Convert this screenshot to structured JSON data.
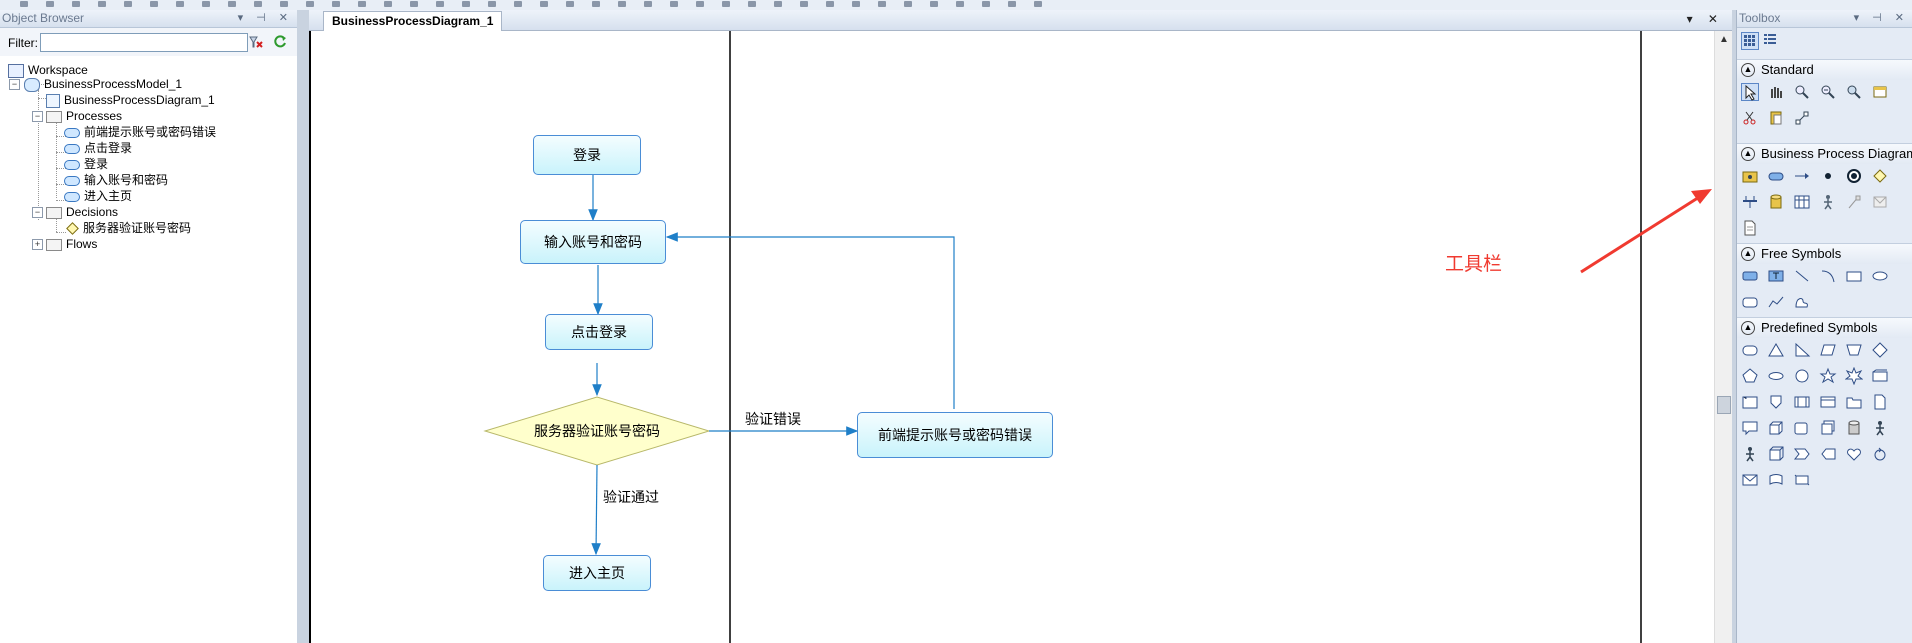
{
  "object_browser": {
    "title": "Object Browser",
    "header_controls": "▾ ⊣ ✕",
    "filter_label": "Filter:",
    "filter_value": "",
    "tree": {
      "workspace": "Workspace",
      "model": "BusinessProcessModel_1",
      "diagram": "BusinessProcessDiagram_1",
      "processes_folder": "Processes",
      "processes": [
        "前端提示账号或密码错误",
        "点击登录",
        "登录",
        "输入账号和密码",
        "进入主页"
      ],
      "decisions_folder": "Decisions",
      "decisions": [
        "服务器验证账号密码"
      ],
      "flows_folder": "Flows"
    }
  },
  "document": {
    "tab_label": "BusinessProcessDiagram_1",
    "tab_controls": "▾ ✕",
    "scroll_up_glyph": "▲"
  },
  "diagram": {
    "nodes": {
      "login": "登录",
      "enter_credentials": "输入账号和密码",
      "click_login": "点击登录",
      "server_verify": "服务器验证账号密码",
      "enter_home": "进入主页",
      "error_prompt": "前端提示账号或密码错误"
    },
    "flow_labels": {
      "verify_error": "验证错误",
      "verify_pass": "验证通过"
    },
    "colors": {
      "node_border": "#4a8dd6",
      "node_fill": "#c9f3fb",
      "decision_fill": "#ffffcc",
      "decision_border": "#b8b86a",
      "connector": "#1f7fc8"
    }
  },
  "annotation": {
    "text": "工具栏",
    "color": "#f03a30"
  },
  "toolbox": {
    "title": "Toolbox",
    "header_controls": "▾ ⊣ ✕",
    "sections": {
      "standard": "Standard",
      "bpd": "Business Process Diagram",
      "free": "Free Symbols",
      "predefined": "Predefined Symbols"
    },
    "standard_tools": [
      "pointer-icon",
      "grabber-icon",
      "zoom-in-icon",
      "zoom-out-icon",
      "zoom-fit-icon",
      "properties-icon",
      "cut-icon",
      "paste-icon",
      "link-icon"
    ],
    "bpd_tools": [
      "package-icon",
      "process-icon",
      "flow-arrow-icon",
      "start-event-icon",
      "end-event-icon",
      "decision-icon",
      "synchronization-icon",
      "data-store-icon",
      "swimlane-icon",
      "role-icon",
      "resource-icon",
      "message-icon",
      "document-icon"
    ],
    "free_tools": [
      "note-icon",
      "text-icon",
      "line-icon",
      "arc-icon",
      "rectangle-icon",
      "ellipse-icon",
      "rounded-rectangle-icon",
      "polyline-icon",
      "freeform-icon"
    ],
    "predefined_tools": [
      "rounded-box-icon",
      "triangle-icon",
      "right-triangle-icon",
      "parallelogram-icon",
      "trapezoid-icon",
      "diamond-icon",
      "pentagon-icon",
      "flat-ellipse-icon",
      "circle-icon",
      "star-icon",
      "burst-icon",
      "card-icon",
      "tab-box-icon",
      "shield-icon",
      "framed-box-icon",
      "window-icon",
      "folder-icon",
      "page-icon",
      "callout-icon",
      "cube-icon",
      "box-icon",
      "stack-icon",
      "cylinder-icon",
      "actor-icon",
      "person-icon",
      "3d-box-icon",
      "chevron-icon",
      "arrow-box-icon",
      "heart-icon",
      "loop-icon",
      "envelope-icon",
      "scroll-icon",
      "banner-icon"
    ]
  }
}
